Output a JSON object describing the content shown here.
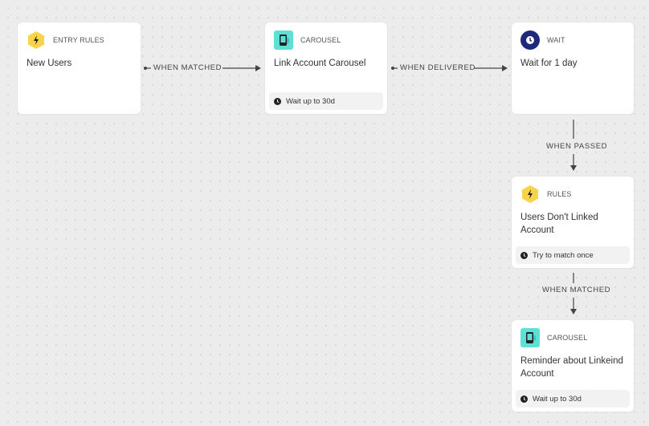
{
  "nodes": [
    {
      "id": "entry-rules",
      "type": "ENTRY RULES",
      "title": "New Users",
      "icon": "lightning-icon",
      "footer": null
    },
    {
      "id": "carousel-1",
      "type": "CAROUSEL",
      "title": "Link Account Carousel",
      "icon": "phone-icon",
      "footer": "Wait up to 30d"
    },
    {
      "id": "wait",
      "type": "WAIT",
      "title": "Wait for 1 day",
      "icon": "clock-icon",
      "footer": null
    },
    {
      "id": "rules",
      "type": "RULES",
      "title": "Users Don't Linked Account",
      "icon": "lightning-icon",
      "footer": "Try to match once"
    },
    {
      "id": "carousel-2",
      "type": "CAROUSEL",
      "title": "Reminder about Linkeind Account",
      "icon": "phone-icon",
      "footer": "Wait up to 30d"
    }
  ],
  "edges": [
    {
      "from": "entry-rules",
      "to": "carousel-1",
      "label": "WHEN MATCHED"
    },
    {
      "from": "carousel-1",
      "to": "wait",
      "label": "WHEN DELIVERED"
    },
    {
      "from": "wait",
      "to": "rules",
      "label": "WHEN PASSED"
    },
    {
      "from": "rules",
      "to": "carousel-2",
      "label": "WHEN MATCHED"
    }
  ],
  "colors": {
    "rules_icon_bg": "#f9d34a",
    "carousel_icon_bg": "#5ee0d6",
    "wait_icon_bg": "#1d2a7a",
    "edge": "#444444"
  }
}
